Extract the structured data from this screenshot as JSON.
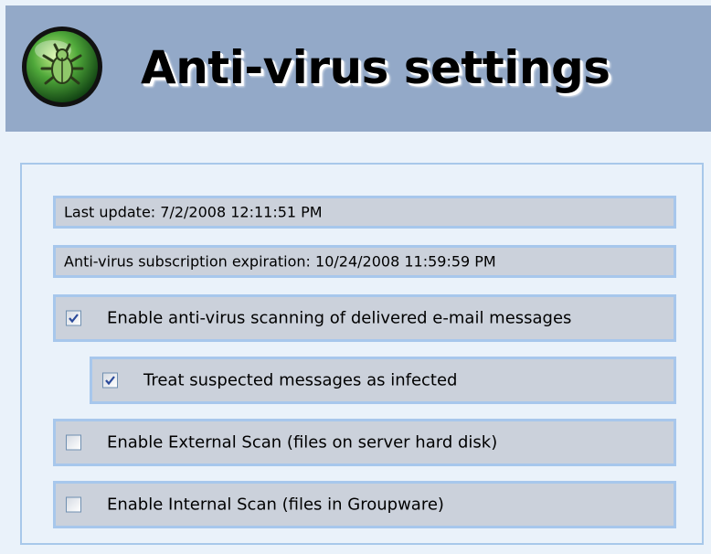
{
  "header": {
    "title": "Anti-virus settings",
    "icon": "bug-shield-icon"
  },
  "info": {
    "last_update": "Last update: 7/2/2008 12:11:51 PM",
    "subscription_expiration": "Anti-virus subscription expiration: 10/24/2008 11:59:59 PM"
  },
  "options": [
    {
      "label": "Enable anti-virus scanning of delivered e-mail messages",
      "checked": true
    },
    {
      "label": "Treat suspected messages as infected",
      "checked": true
    },
    {
      "label": "Enable External Scan (files on server hard disk)",
      "checked": false
    },
    {
      "label": "Enable Internal Scan (files in Groupware)",
      "checked": false
    }
  ],
  "colors": {
    "header_bg": "#93a9c8",
    "page_bg": "#eaf2fa",
    "row_bg": "#cbd1db",
    "row_border": "#a7c7ec",
    "check_color": "#2b4a9a"
  }
}
